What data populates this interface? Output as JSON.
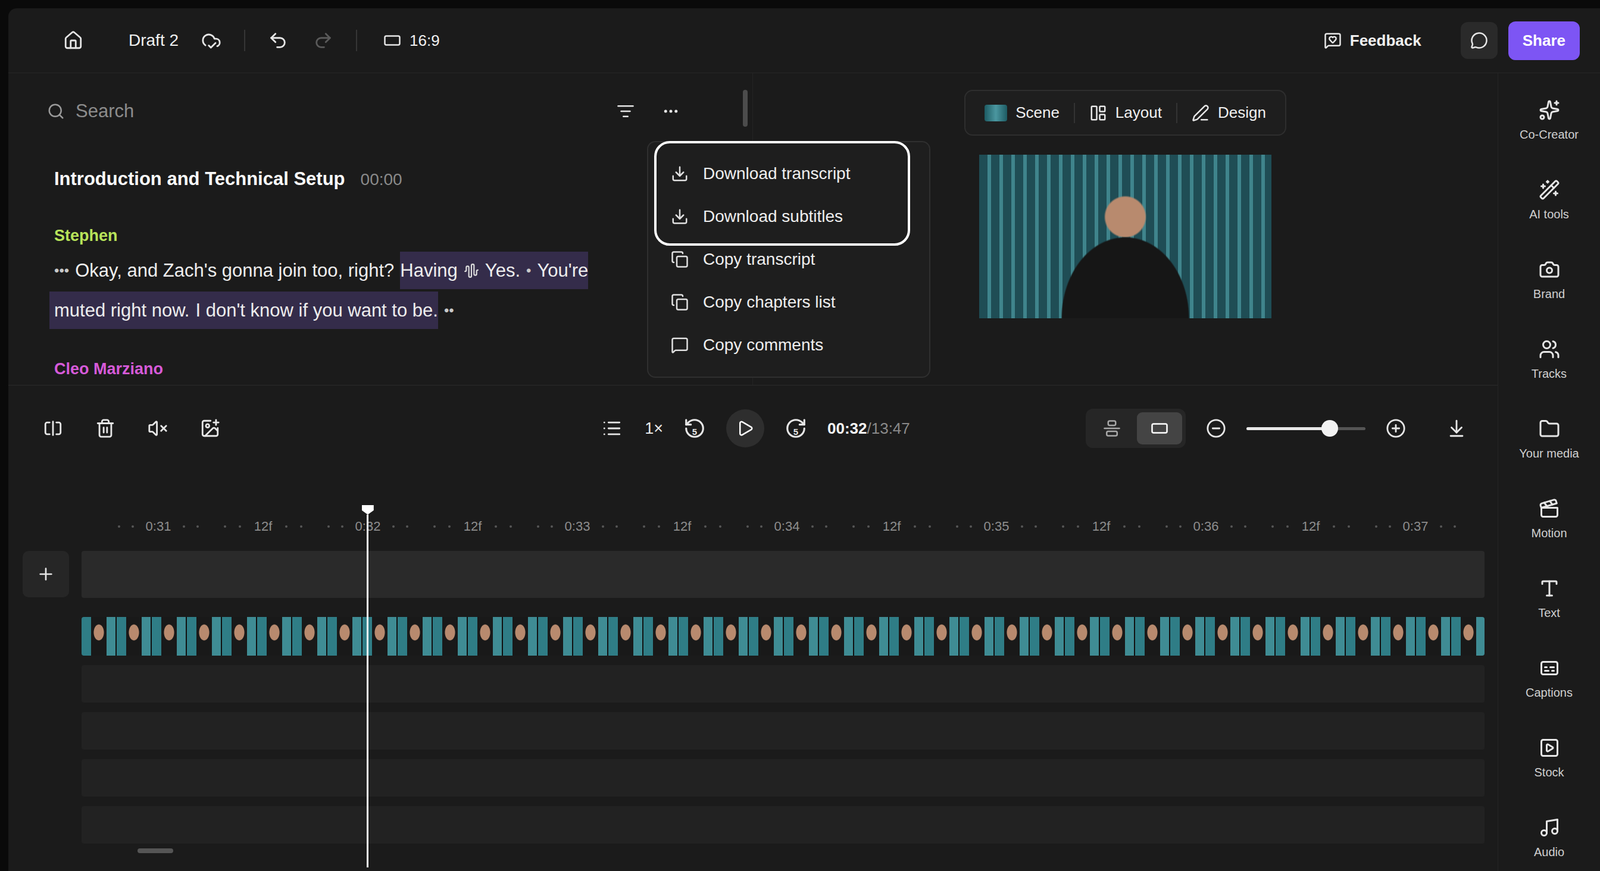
{
  "topbar": {
    "title": "Draft 2",
    "aspect": "16:9",
    "feedback": "Feedback",
    "share": "Share",
    "undo_enabled": true,
    "redo_enabled": false
  },
  "transcript": {
    "search_placeholder": "Search",
    "chapter": {
      "title": "Introduction and Technical Setup",
      "time": "00:00"
    },
    "speakers": [
      {
        "name": "Stephen",
        "color": "#b8e35a",
        "lines": [
          [
            {
              "kind": "pause",
              "text": "•••",
              "selected": false
            },
            {
              "kind": "text",
              "text": "Okay, and Zach's gonna join too, right?",
              "selected": false
            },
            {
              "kind": "text",
              "text": "Having",
              "selected": true
            },
            {
              "kind": "wave",
              "text": "",
              "selected": true
            },
            {
              "kind": "text",
              "text": "Yes.",
              "selected": true
            },
            {
              "kind": "pause",
              "text": "•",
              "selected": true
            },
            {
              "kind": "text",
              "text": "You're",
              "selected": true
            }
          ],
          [
            {
              "kind": "text",
              "text": "muted right now.",
              "selected": true
            },
            {
              "kind": "text",
              "text": "I don't know if you want to be.",
              "selected": true
            },
            {
              "kind": "pause",
              "text": "••",
              "selected": false
            }
          ]
        ]
      },
      {
        "name": "Cleo Marziano",
        "color": "#d65ad9",
        "lines": []
      }
    ]
  },
  "menu": {
    "items": [
      {
        "label": "Download transcript",
        "kind": "download",
        "outlined": true
      },
      {
        "label": "Download subtitles",
        "kind": "download",
        "outlined": true
      },
      {
        "label": "Copy transcript",
        "kind": "copy",
        "outlined": false
      },
      {
        "label": "Copy chapters list",
        "kind": "copy",
        "outlined": false
      },
      {
        "label": "Copy comments",
        "kind": "comment",
        "outlined": false
      }
    ]
  },
  "preview": {
    "tabs": [
      {
        "label": "Scene",
        "kind": "scene"
      },
      {
        "label": "Layout",
        "kind": "layout"
      },
      {
        "label": "Design",
        "kind": "design"
      }
    ]
  },
  "sidebar": {
    "items": [
      {
        "label": "Co-Creator",
        "kind": "cocreator"
      },
      {
        "label": "AI tools",
        "kind": "ai"
      },
      {
        "label": "Brand",
        "kind": "brand"
      },
      {
        "label": "Tracks",
        "kind": "tracks"
      },
      {
        "label": "Your media",
        "kind": "media"
      },
      {
        "label": "Motion",
        "kind": "motion"
      },
      {
        "label": "Text",
        "kind": "text"
      },
      {
        "label": "Captions",
        "kind": "captions"
      },
      {
        "label": "Stock",
        "kind": "stock"
      },
      {
        "label": "Audio",
        "kind": "audio"
      }
    ]
  },
  "playback": {
    "speed": "1×",
    "skip_back": "5",
    "skip_forward": "5",
    "time": "00:32",
    "duration": "/13:47"
  },
  "view_toggle": [
    {
      "kind": "stacked",
      "selected": false
    },
    {
      "kind": "single",
      "selected": true
    }
  ],
  "zoom": {
    "level": 0.7
  },
  "ruler": [
    "0:31",
    "12f",
    "0:32",
    "12f",
    "0:33",
    "12f",
    "0:34",
    "12f",
    "0:35",
    "12f",
    "0:36",
    "12f",
    "0:37"
  ],
  "playhead": {
    "level": 0.204
  },
  "tracks": [
    {
      "kind": "empty"
    },
    {
      "kind": "video"
    },
    {
      "kind": "lane"
    },
    {
      "kind": "lane"
    },
    {
      "kind": "lane"
    },
    {
      "kind": "lane"
    }
  ]
}
